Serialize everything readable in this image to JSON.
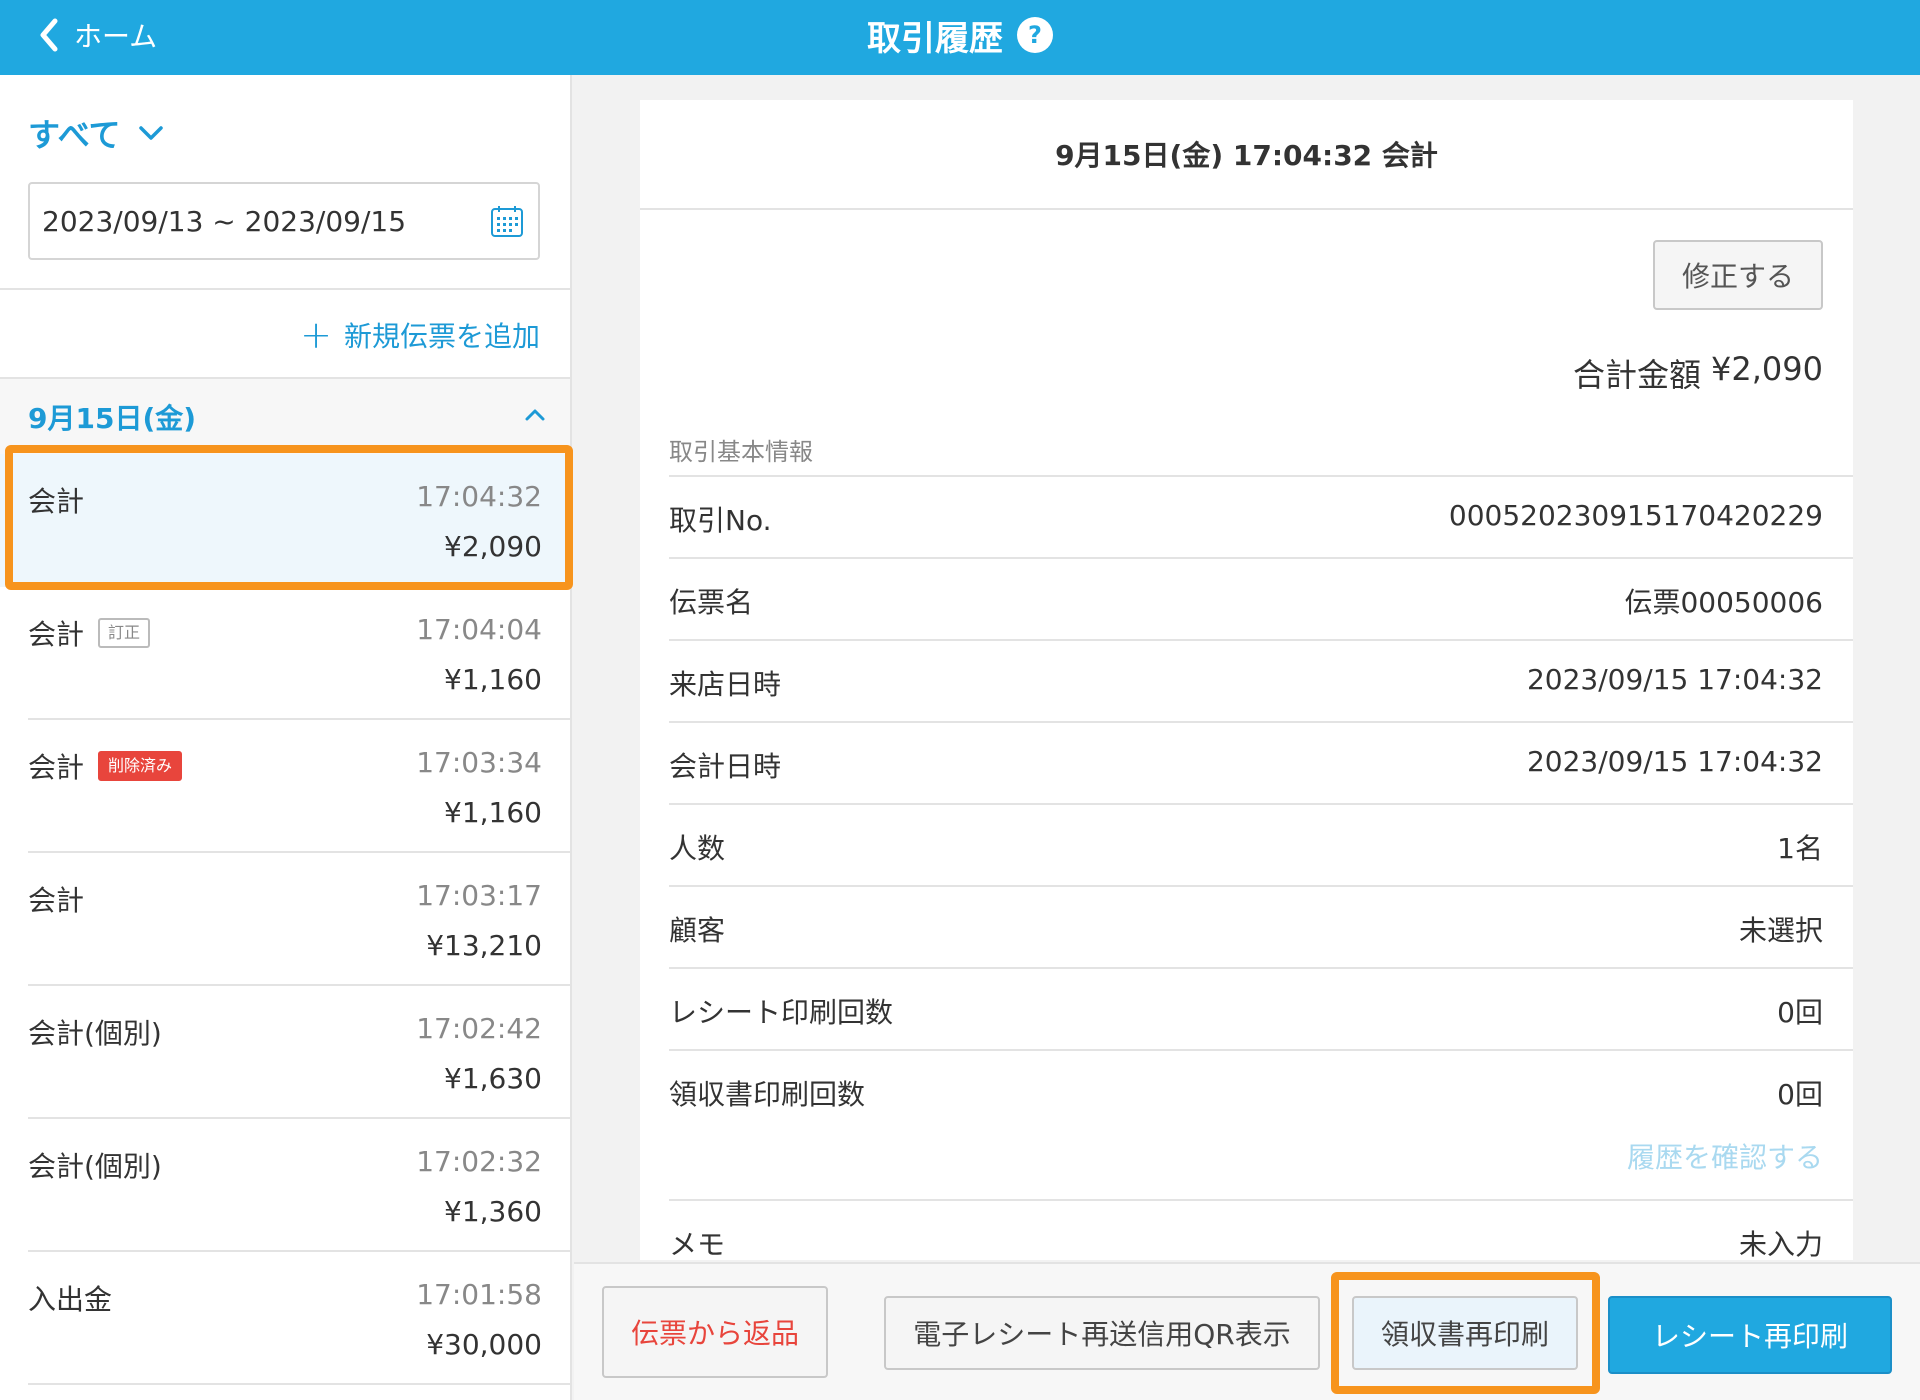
{
  "header": {
    "back_label": "ホーム",
    "title": "取引履歴",
    "help_glyph": "?"
  },
  "sidebar": {
    "filter_label": "すべて",
    "date_range": "2023/09/13 ~ 2023/09/15",
    "add_slip_label": "新規伝票を追加",
    "date_group_label": "9月15日(金)",
    "transactions": [
      {
        "name": "会計",
        "badge": "",
        "time": "17:04:32",
        "amount": "¥2,090"
      },
      {
        "name": "会計",
        "badge": "訂正",
        "time": "17:04:04",
        "amount": "¥1,160"
      },
      {
        "name": "会計",
        "badge": "削除済み",
        "time": "17:03:34",
        "amount": "¥1,160"
      },
      {
        "name": "会計",
        "badge": "",
        "time": "17:03:17",
        "amount": "¥13,210"
      },
      {
        "name": "会計(個別)",
        "badge": "",
        "time": "17:02:42",
        "amount": "¥1,630"
      },
      {
        "name": "会計(個別)",
        "badge": "",
        "time": "17:02:32",
        "amount": "¥1,360"
      },
      {
        "name": "入出金",
        "badge": "",
        "time": "17:01:58",
        "amount": "¥30,000"
      }
    ]
  },
  "detail": {
    "title": "9月15日(金) 17:04:32 会計",
    "edit_label": "修正する",
    "total_label": "合計金額",
    "total_value": "¥2,090",
    "section_label": "取引基本情報",
    "rows": [
      {
        "key": "取引No.",
        "value": "000520230915170420229"
      },
      {
        "key": "伝票名",
        "value": "伝票00050006"
      },
      {
        "key": "来店日時",
        "value": "2023/09/15 17:04:32"
      },
      {
        "key": "会計日時",
        "value": "2023/09/15 17:04:32"
      },
      {
        "key": "人数",
        "value": "1名"
      },
      {
        "key": "顧客",
        "value": "未選択"
      },
      {
        "key": "レシート印刷回数",
        "value": "0回"
      },
      {
        "key": "領収書印刷回数",
        "value": "0回"
      },
      {
        "key": "メモ",
        "value": "未入力"
      }
    ],
    "history_link": "履歴を確認する"
  },
  "footer": {
    "return_label": "伝票から返品",
    "qr_label": "電子レシート再送信用QR表示",
    "receipt_label": "領収書再印刷",
    "reprint_label": "レシート再印刷"
  },
  "colors": {
    "header_bg": "#20a8e0",
    "accent": "#1d9ad6",
    "highlight": "#f7941d",
    "deleted_badge": "#e8453c"
  }
}
